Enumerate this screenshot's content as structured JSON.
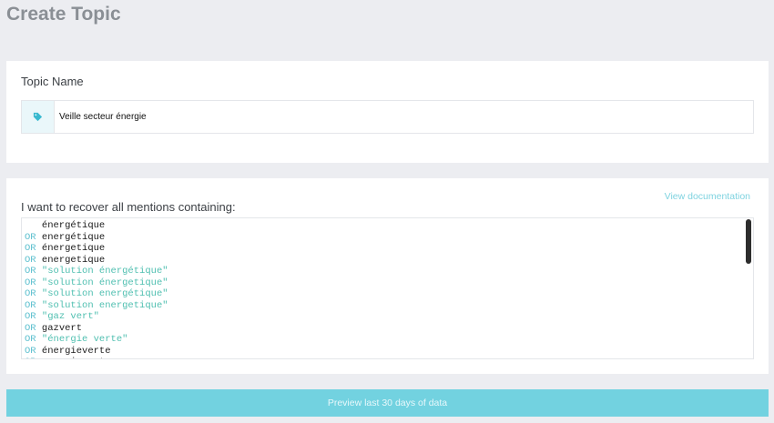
{
  "page": {
    "title": "Create Topic"
  },
  "topic_name": {
    "label": "Topic Name",
    "value": "Veille secteur énergie",
    "icon": "tag-icon"
  },
  "query": {
    "label": "I want to recover all mentions containing:",
    "doc_link": "View documentation",
    "lines": [
      {
        "op": "",
        "text": "énergétique",
        "kind": "term"
      },
      {
        "op": "OR",
        "text": "energétique",
        "kind": "term"
      },
      {
        "op": "OR",
        "text": "énergetique",
        "kind": "term"
      },
      {
        "op": "OR",
        "text": "energetique",
        "kind": "term"
      },
      {
        "op": "OR",
        "text": "\"solution énergétique\"",
        "kind": "phrase"
      },
      {
        "op": "OR",
        "text": "\"solution énergetique\"",
        "kind": "phrase"
      },
      {
        "op": "OR",
        "text": "\"solution energétique\"",
        "kind": "phrase"
      },
      {
        "op": "OR",
        "text": "\"solution energetique\"",
        "kind": "phrase"
      },
      {
        "op": "OR",
        "text": "\"gaz vert\"",
        "kind": "phrase"
      },
      {
        "op": "OR",
        "text": "gazvert",
        "kind": "term"
      },
      {
        "op": "OR",
        "text": "\"énergie verte\"",
        "kind": "phrase"
      },
      {
        "op": "OR",
        "text": "énergieverte",
        "kind": "term"
      },
      {
        "op": "OR",
        "text": "energieverte",
        "kind": "term"
      }
    ]
  },
  "preview_button": {
    "label": "Preview last 30 days of data"
  },
  "colors": {
    "accent": "#72d2e0",
    "operator": "#5bbfce",
    "phrase": "#4fbfb0",
    "background": "#ecedf1"
  }
}
